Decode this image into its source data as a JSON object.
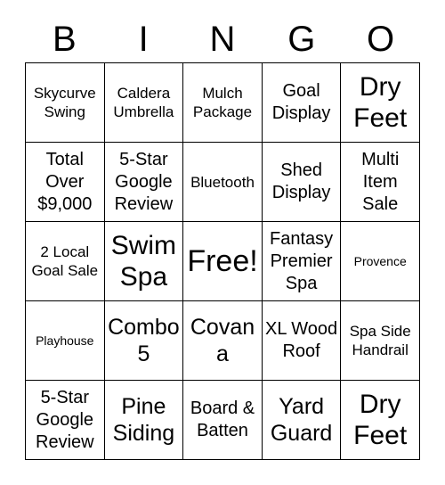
{
  "card": {
    "title": "BINGO",
    "header_letters": [
      "B",
      "I",
      "N",
      "G",
      "O"
    ],
    "free_space_label": "Free!",
    "colors": {
      "background": "#ffffff",
      "text": "#000000",
      "border": "#000000"
    },
    "rows": [
      [
        {
          "text": "Skycurve Swing",
          "size": "s"
        },
        {
          "text": "Caldera Umbrella",
          "size": "s"
        },
        {
          "text": "Mulch Package",
          "size": "s"
        },
        {
          "text": "Goal Display",
          "size": "m"
        },
        {
          "text": "Dry Feet",
          "size": "xl"
        }
      ],
      [
        {
          "text": "Total Over $9,000",
          "size": "m"
        },
        {
          "text": "5-Star Google Review",
          "size": "m"
        },
        {
          "text": "Bluetooth",
          "size": "s"
        },
        {
          "text": "Shed Display",
          "size": "m"
        },
        {
          "text": "Multi Item Sale",
          "size": "m"
        }
      ],
      [
        {
          "text": "2 Local Goal Sale",
          "size": "s"
        },
        {
          "text": "Swim Spa",
          "size": "xl"
        },
        {
          "text": "Free!",
          "size": "xxl"
        },
        {
          "text": "Fantasy Premier Spa",
          "size": "m"
        },
        {
          "text": "Provence",
          "size": "xs"
        }
      ],
      [
        {
          "text": "Playhouse",
          "size": "xs"
        },
        {
          "text": "Combo 5",
          "size": "l"
        },
        {
          "text": "Covana",
          "size": "l"
        },
        {
          "text": "XL Wood Roof",
          "size": "m"
        },
        {
          "text": "Spa Side Handrail",
          "size": "s"
        }
      ],
      [
        {
          "text": "5-Star Google Review",
          "size": "m"
        },
        {
          "text": "Pine Siding",
          "size": "l"
        },
        {
          "text": "Board & Batten",
          "size": "m"
        },
        {
          "text": "Yard Guard",
          "size": "l"
        },
        {
          "text": "Dry Feet",
          "size": "xl"
        }
      ]
    ]
  }
}
